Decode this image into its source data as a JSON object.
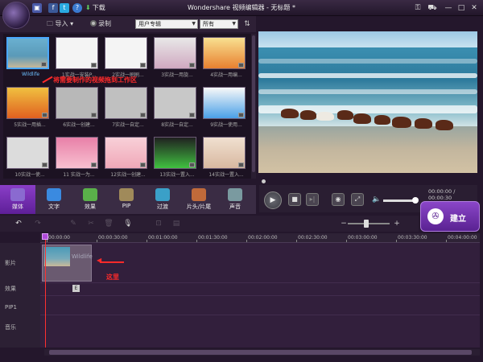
{
  "app": {
    "title": "Wondershare 视频编辑器 - 无标题 *",
    "download": "下载"
  },
  "library": {
    "import_label": "导入",
    "record_label": "录制",
    "filter_value": "用户专辑",
    "filter2_value": "所有",
    "items": [
      {
        "caption": "Wildlife"
      },
      {
        "caption": "1实战一安装P..."
      },
      {
        "caption": "2实战一刷刷..."
      },
      {
        "caption": "3实战一用旋..."
      },
      {
        "caption": "4实战一用编..."
      },
      {
        "caption": "5实战一用插..."
      },
      {
        "caption": "6实战一创建..."
      },
      {
        "caption": "7实战一自定..."
      },
      {
        "caption": "8实战一自定..."
      },
      {
        "caption": "9实战一使用..."
      },
      {
        "caption": "10实战一使..."
      },
      {
        "caption": "11 实战一为..."
      },
      {
        "caption": "12实战一创建..."
      },
      {
        "caption": "13实战一置入..."
      },
      {
        "caption": "14实战一置入..."
      }
    ]
  },
  "annotations": {
    "library_hint": "将需要制作的视频拖到工作区",
    "timeline_hint": "这里"
  },
  "preview": {
    "time": "00:00:00 / 00:00:30"
  },
  "tabs": [
    {
      "label": "媒体",
      "color": "#8a6ad0"
    },
    {
      "label": "文字",
      "color": "#3a8ae0"
    },
    {
      "label": "效果",
      "color": "#5ab04a"
    },
    {
      "label": "PIP",
      "color": "#a08a5a"
    },
    {
      "label": "过渡",
      "color": "#3aa0c8"
    },
    {
      "label": "片头/片尾",
      "color": "#c06a3a"
    },
    {
      "label": "声音",
      "color": "#7a9aa0"
    }
  ],
  "create_button": "建立",
  "ruler": [
    "00:00:00",
    "00:00:30:00",
    "00:01:00:00",
    "00:01:30:00",
    "00:02:00:00",
    "00:02:30:00",
    "00:03:00:00",
    "00:03:30:00",
    "00:04:00:00"
  ],
  "tracks": {
    "video": "影片",
    "effects": "效果",
    "pip": "PIP1",
    "music": "音乐",
    "clip_title": "Wildlife"
  }
}
